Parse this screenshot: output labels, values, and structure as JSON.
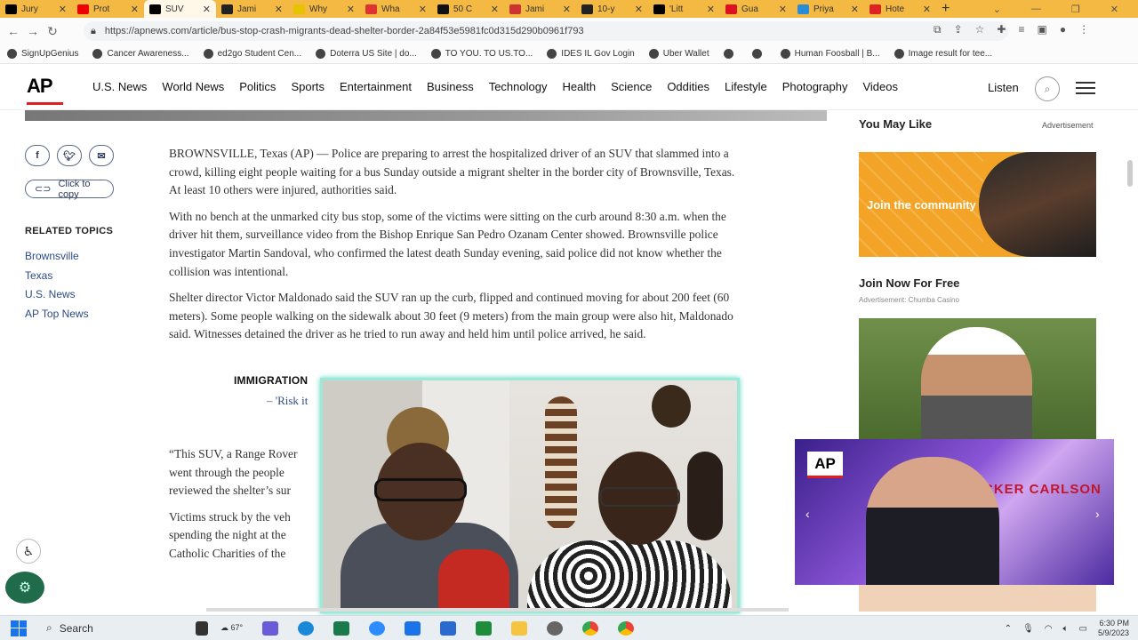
{
  "browser": {
    "tabs": [
      {
        "label": "Jury",
        "icon": "ap-icon",
        "color": "#000"
      },
      {
        "label": "Prot",
        "icon": "youtube-icon",
        "color": "#e00"
      },
      {
        "label": "SUV",
        "icon": "ap-icon",
        "color": "#000",
        "active": true
      },
      {
        "label": "Jami",
        "icon": "r-icon",
        "color": "#222"
      },
      {
        "label": "Why",
        "icon": "v-icon",
        "color": "#e6c200"
      },
      {
        "label": "Wha",
        "icon": "news-icon",
        "color": "#d33"
      },
      {
        "label": "50 C",
        "icon": "b-icon",
        "color": "#111"
      },
      {
        "label": "Jami",
        "icon": "news-icon",
        "color": "#c33"
      },
      {
        "label": "10-y",
        "icon": "cloud-icon",
        "color": "#222"
      },
      {
        "label": "'Litt",
        "icon": "ap-icon",
        "color": "#000"
      },
      {
        "label": "Gua",
        "icon": "opera-icon",
        "color": "#d12"
      },
      {
        "label": "Priya",
        "icon": "p-icon",
        "color": "#2a8bd8"
      },
      {
        "label": "Hote",
        "icon": "4-icon",
        "color": "#d22"
      }
    ],
    "url": "https://apnews.com/article/bus-stop-crash-migrants-dead-shelter-border-2a84f53e5981fc0d315d290b0961f793",
    "bookmarks": [
      "SignUpGenius",
      "Cancer Awareness...",
      "ed2go Student Cen...",
      "Doterra US Site | do...",
      "TO YOU. TO US.TO...",
      "IDES IL Gov Login",
      "Uber Wallet",
      "",
      "",
      "Human Foosball | B...",
      "Image result for tee..."
    ]
  },
  "site": {
    "logo": "AP",
    "nav": [
      "U.S. News",
      "World News",
      "Politics",
      "Sports",
      "Entertainment",
      "Business",
      "Technology",
      "Health",
      "Science",
      "Oddities",
      "Lifestyle",
      "Photography",
      "Videos"
    ],
    "listen": "Listen"
  },
  "share": {
    "copy_label": "Click to copy"
  },
  "related": {
    "heading": "RELATED TOPICS",
    "items": [
      "Brownsville",
      "Texas",
      "U.S. News",
      "AP Top News"
    ]
  },
  "article": {
    "paragraphs": [
      "BROWNSVILLE, Texas (AP) — Police are preparing to arrest the hospitalized driver of an SUV that slammed into a crowd, killing eight people waiting for a bus Sunday outside a migrant shelter in the border city of Brownsville, Texas. At least 10 others were injured, authorities said.",
      "With no bench at the unmarked city bus stop, some of the victims were sitting on the curb around 8:30 a.m. when the driver hit them, surveillance video from the Bishop Enrique San Pedro Ozanam Center showed. Brownsville police investigator Martin Sandoval, who confirmed the latest death Sunday evening, said police did not know whether the collision was intentional.",
      "Shelter director Victor Maldonado said the SUV ran up the curb, flipped and continued moving for about 200 feet (60 meters). Some people walking on the sidewalk about 30 feet (9 meters) from the main group were also hit, Maldonado said. Witnesses detained the driver as he tried to run away and held him until police arrived, he said."
    ],
    "related_heading": "IMMIGRATION",
    "related_link": "– 'Risk it",
    "partial": [
      [
        "“This SUV, a Range Rover",
        "went through the people",
        "reviewed the shelter’s sur"
      ],
      [
        "Victims struck by the veh",
        "spending the night at the",
        "Catholic Charities of the"
      ]
    ]
  },
  "sidebar": {
    "heading": "You May Like",
    "advertisement": "Advertisement",
    "ad1_text": "Join the community",
    "ad1_title": "Join Now For Free",
    "ad1_source": "Advertisement: Chumba Casino",
    "video_logo": "AP",
    "video_title": "TUCKER CARLSON"
  },
  "taskbar": {
    "search": "Search",
    "weather": "67°",
    "time": "6:30 PM",
    "date": "5/9/2023"
  }
}
